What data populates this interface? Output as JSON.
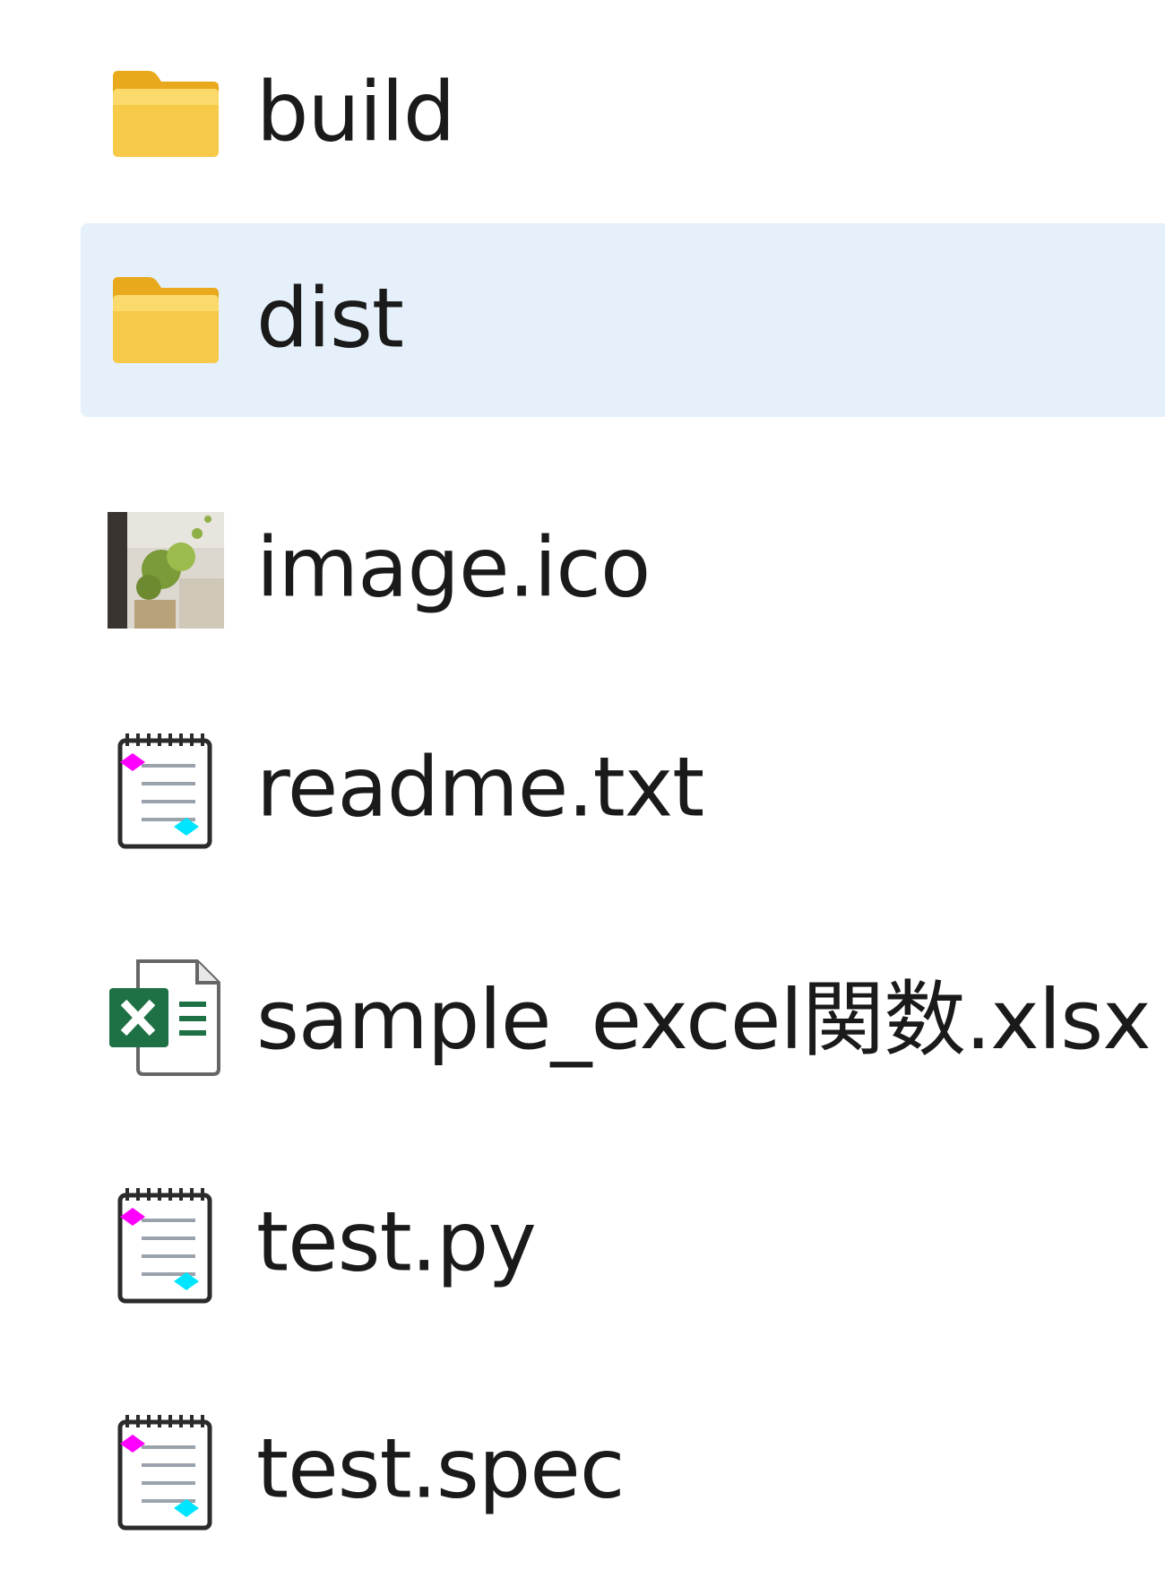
{
  "files": [
    {
      "name": "build",
      "icon": "folder-icon",
      "selected": false
    },
    {
      "name": "dist",
      "icon": "folder-icon",
      "selected": true
    },
    {
      "name": "image.ico",
      "icon": "image-thumbnail-icon",
      "selected": false
    },
    {
      "name": "readme.txt",
      "icon": "text-file-icon",
      "selected": false
    },
    {
      "name": "sample_excel関数.xlsx",
      "icon": "excel-file-icon",
      "selected": false
    },
    {
      "name": "test.py",
      "icon": "text-file-icon",
      "selected": false
    },
    {
      "name": "test.spec",
      "icon": "text-file-icon",
      "selected": false
    }
  ],
  "colors": {
    "selected_background": "#e5f0fb",
    "folder": "#f7c948",
    "excel": "#1e7145"
  }
}
